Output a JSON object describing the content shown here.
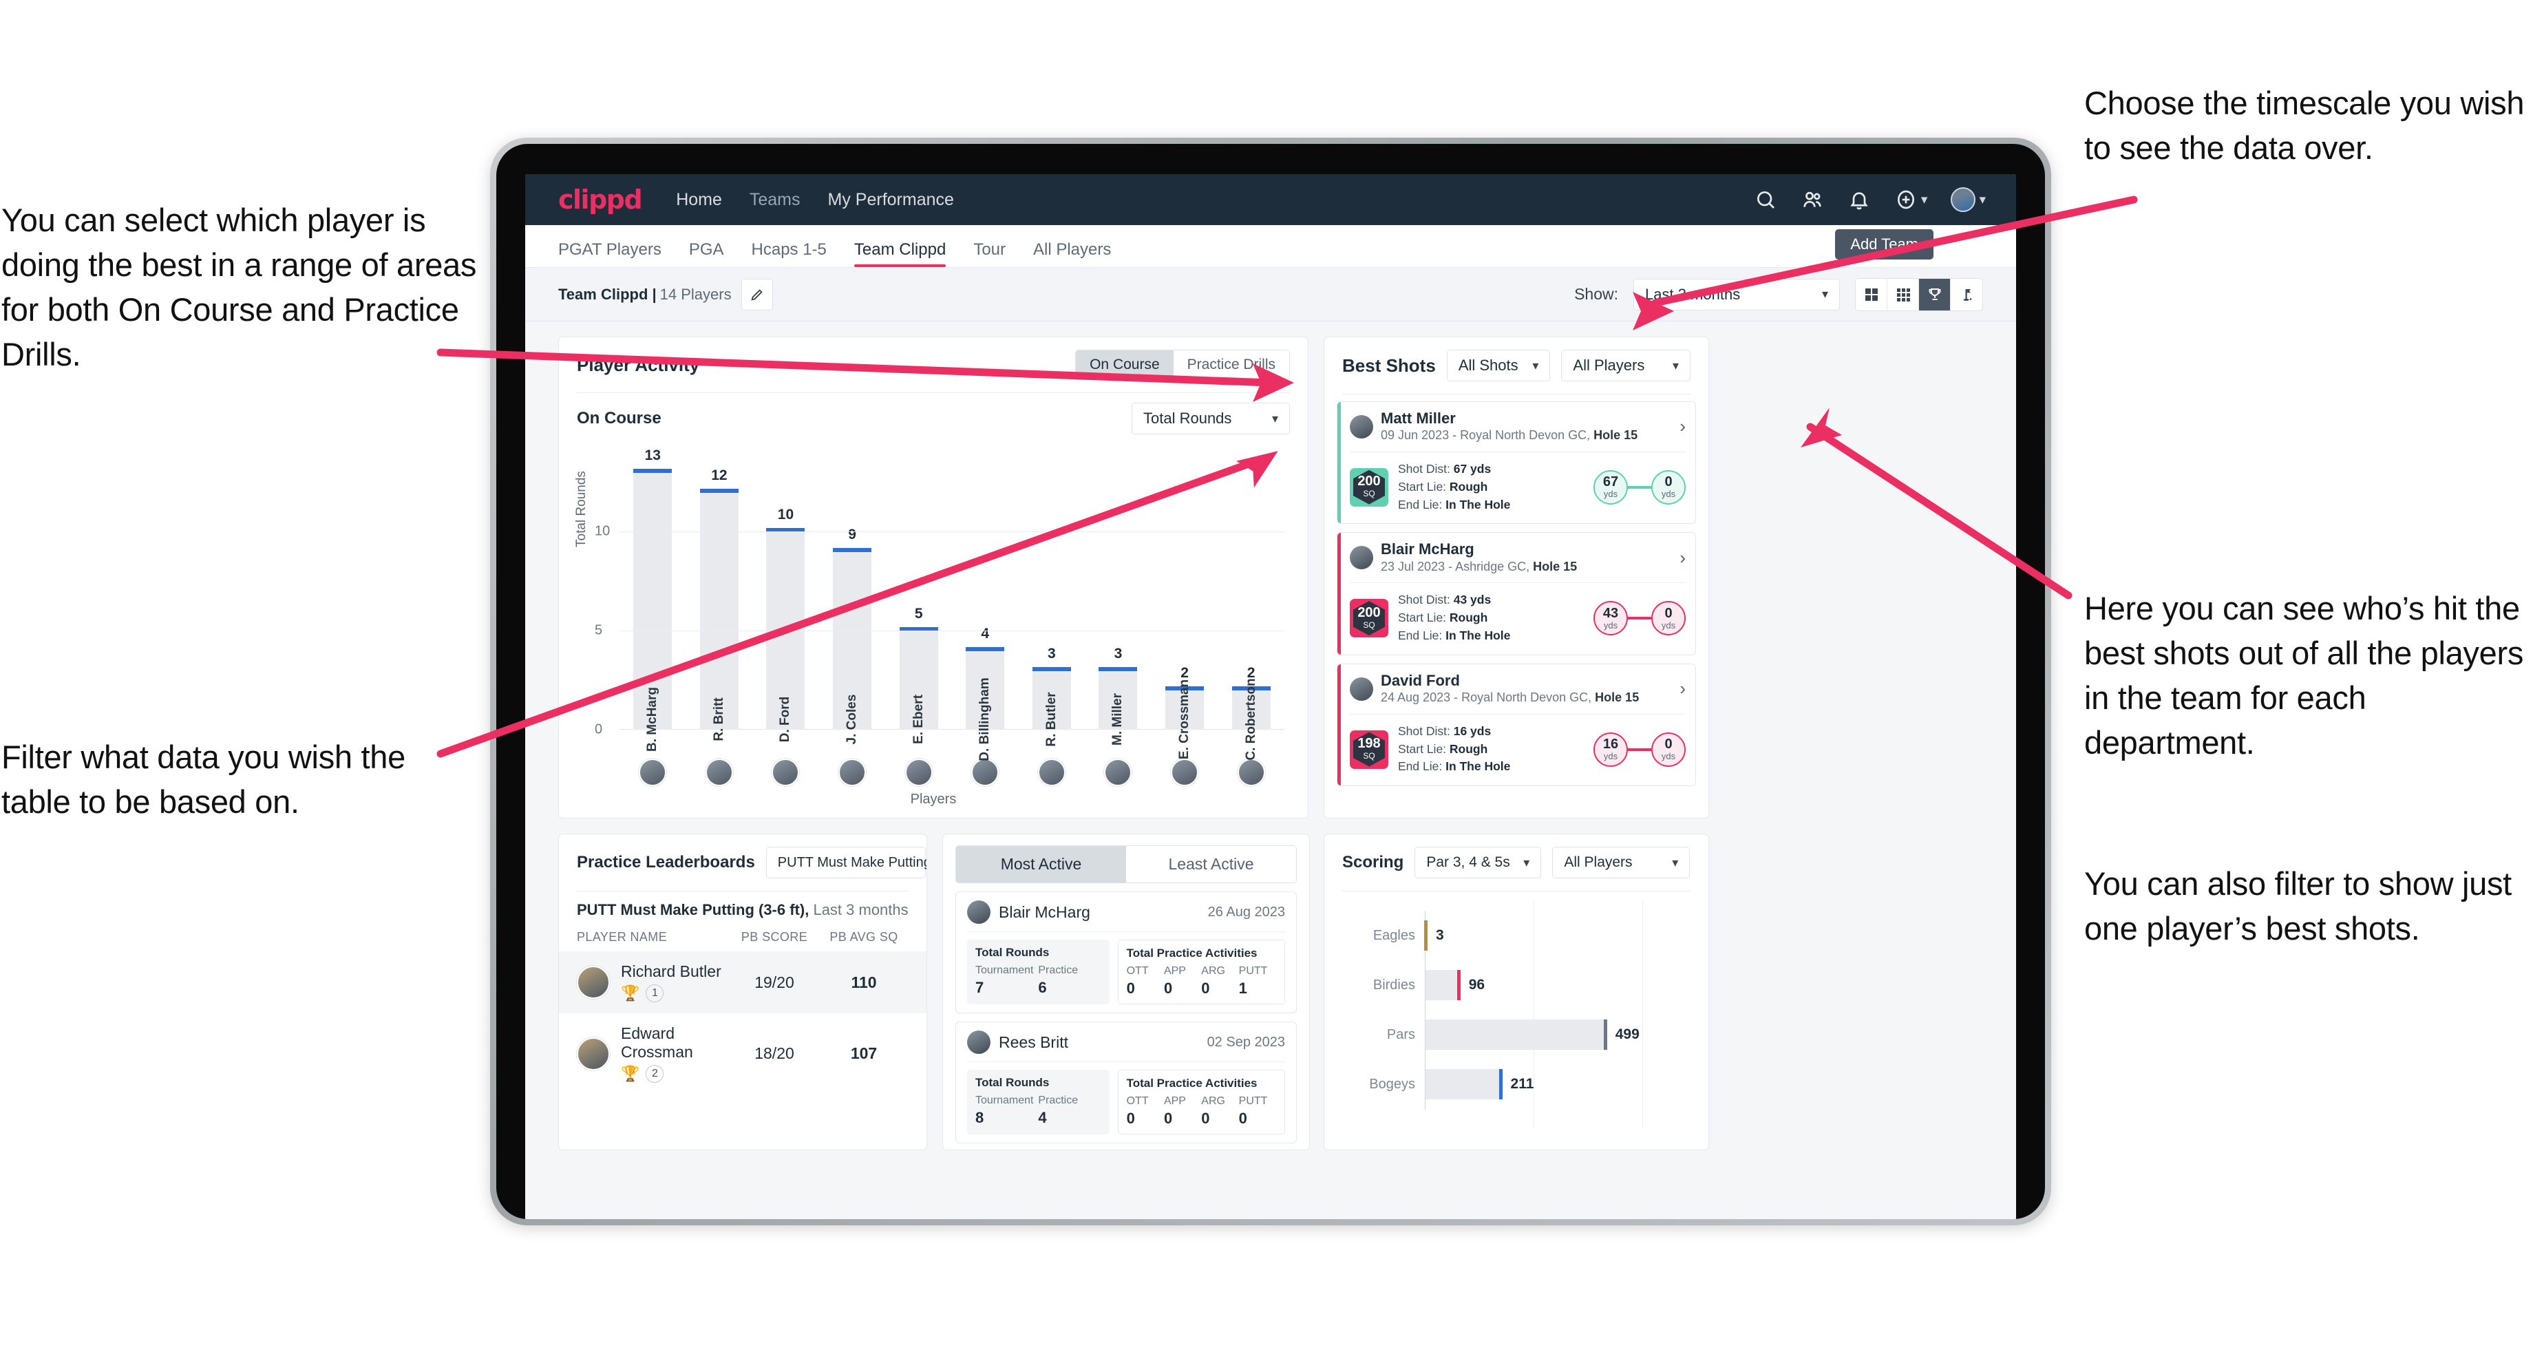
{
  "annotations": {
    "left_top": "You can select which player is doing the best in a range of areas for both On Course and Practice Drills.",
    "left_bottom": "Filter what data you wish the table to be based on.",
    "right_top": "Choose the timescale you wish to see the data over.",
    "right_middle": "Here you can see who’s hit the best shots out of all the players in the team for each department.",
    "right_bottom": "You can also filter to show just one player’s best shots."
  },
  "topnav": {
    "logo": "clippd",
    "links": [
      {
        "label": "Home",
        "dim": false
      },
      {
        "label": "Teams",
        "dim": true
      },
      {
        "label": "My Performance",
        "dim": false
      }
    ],
    "icons": [
      "search-icon",
      "people-icon",
      "bell-icon",
      "plus-circle-icon",
      "avatar"
    ]
  },
  "subtabs": {
    "items": [
      {
        "label": "PGAT Players",
        "active": false
      },
      {
        "label": "PGA",
        "active": false
      },
      {
        "label": "Hcaps 1-5",
        "active": false
      },
      {
        "label": "Team Clippd",
        "active": true
      },
      {
        "label": "Tour",
        "active": false
      },
      {
        "label": "All Players",
        "active": false
      }
    ],
    "add_team_button": "Add Team"
  },
  "filterbar": {
    "team_name": "Team Clippd |",
    "team_players": "14 Players",
    "edit_icon": "pencil-icon",
    "show_label": "Show:",
    "timescale_value": "Last 3 months",
    "view_icons": [
      "grid-large-icon",
      "grid-small-icon",
      "trophy-icon",
      "golf-flag-icon"
    ],
    "active_view_index": 2
  },
  "player_activity": {
    "title": "Player Activity",
    "toggle": {
      "options": [
        "On Course",
        "Practice Drills"
      ],
      "selected": "On Course"
    },
    "sub_label": "On Course",
    "metric_select": "Total Rounds"
  },
  "chart_data": [
    {
      "type": "bar",
      "title": "Player Activity",
      "xlabel": "Players",
      "ylabel": "Total Rounds",
      "ylim": [
        0,
        14
      ],
      "yticks": [
        0,
        5,
        10
      ],
      "grid": true,
      "categories": [
        "B. McHarg",
        "R. Britt",
        "D. Ford",
        "J. Coles",
        "E. Ebert",
        "D. Billingham",
        "R. Butler",
        "M. Miller",
        "E. Crossman",
        "C. Robertson"
      ],
      "values": [
        13,
        12,
        10,
        9,
        5,
        4,
        3,
        3,
        2,
        2
      ]
    },
    {
      "type": "bar",
      "title": "Scoring",
      "orientation": "horizontal",
      "categories": [
        "Eagles",
        "Birdies",
        "Pars",
        "Bogeys"
      ],
      "values": [
        3,
        96,
        499,
        211
      ],
      "colors": [
        "#b5903c",
        "#ec2f62",
        "#6b7884",
        "#2f6fd0"
      ],
      "xlabel": "",
      "ylabel": "",
      "grid": true
    }
  ],
  "best_shots": {
    "title": "Best Shots",
    "shot_filter": "All Shots",
    "player_filter": "All Players",
    "cards": [
      {
        "name": "Matt Miller",
        "meta_date": "09 Jun 2023 - Royal North Devon GC,",
        "meta_hole": "Hole 15",
        "sq": "200",
        "sq_unit": "SQ",
        "accent": "#5fd0b0",
        "shot_dist_label": "Shot Dist:",
        "shot_dist": "67 yds",
        "start_lie_label": "Start Lie:",
        "start_lie": "Rough",
        "end_lie_label": "End Lie:",
        "end_lie": "In The Hole",
        "from_val": "67",
        "from_unit": "yds",
        "to_val": "0",
        "to_unit": "yds"
      },
      {
        "name": "Blair McHarg",
        "meta_date": "23 Jul 2023 - Ashridge GC,",
        "meta_hole": "Hole 15",
        "sq": "200",
        "sq_unit": "SQ",
        "accent": "#ec2f62",
        "shot_dist_label": "Shot Dist:",
        "shot_dist": "43 yds",
        "start_lie_label": "Start Lie:",
        "start_lie": "Rough",
        "end_lie_label": "End Lie:",
        "end_lie": "In The Hole",
        "from_val": "43",
        "from_unit": "yds",
        "to_val": "0",
        "to_unit": "yds"
      },
      {
        "name": "David Ford",
        "meta_date": "24 Aug 2023 - Royal North Devon GC,",
        "meta_hole": "Hole 15",
        "sq": "198",
        "sq_unit": "SQ",
        "accent": "#ec2f62",
        "shot_dist_label": "Shot Dist:",
        "shot_dist": "16 yds",
        "start_lie_label": "Start Lie:",
        "start_lie": "Rough",
        "end_lie_label": "End Lie:",
        "end_lie": "In The Hole",
        "from_val": "16",
        "from_unit": "yds",
        "to_val": "0",
        "to_unit": "yds"
      }
    ]
  },
  "practice_leaderboards": {
    "title": "Practice Leaderboards",
    "drill_select": "PUTT Must Make Putting ...",
    "subtitle_bold": "PUTT Must Make Putting (3-6 ft),",
    "subtitle_light": "Last 3 months",
    "columns": [
      "PLAYER NAME",
      "PB SCORE",
      "PB AVG SQ"
    ],
    "rows": [
      {
        "name": "Richard Butler",
        "rank": "1",
        "trophy": "gold",
        "pb_score": "19/20",
        "pb_avg_sq": "110"
      },
      {
        "name": "Edward Crossman",
        "rank": "2",
        "trophy": "silver",
        "pb_score": "18/20",
        "pb_avg_sq": "107"
      }
    ]
  },
  "activity": {
    "tabs": [
      "Most Active",
      "Least Active"
    ],
    "selected_tab": "Most Active",
    "rounds_label": "Total Rounds",
    "practice_label": "Total Practice Activities",
    "rounds_keys": [
      "Tournament",
      "Practice"
    ],
    "practice_keys": [
      "OTT",
      "APP",
      "ARG",
      "PUTT"
    ],
    "cards": [
      {
        "name": "Blair McHarg",
        "date": "26 Aug 2023",
        "rounds": [
          "7",
          "6"
        ],
        "practice": [
          "0",
          "0",
          "0",
          "1"
        ]
      },
      {
        "name": "Rees Britt",
        "date": "02 Sep 2023",
        "rounds": [
          "8",
          "4"
        ],
        "practice": [
          "0",
          "0",
          "0",
          "0"
        ]
      }
    ]
  },
  "scoring": {
    "title": "Scoring",
    "par_filter": "Par 3, 4 & 5s",
    "player_filter": "All Players"
  }
}
